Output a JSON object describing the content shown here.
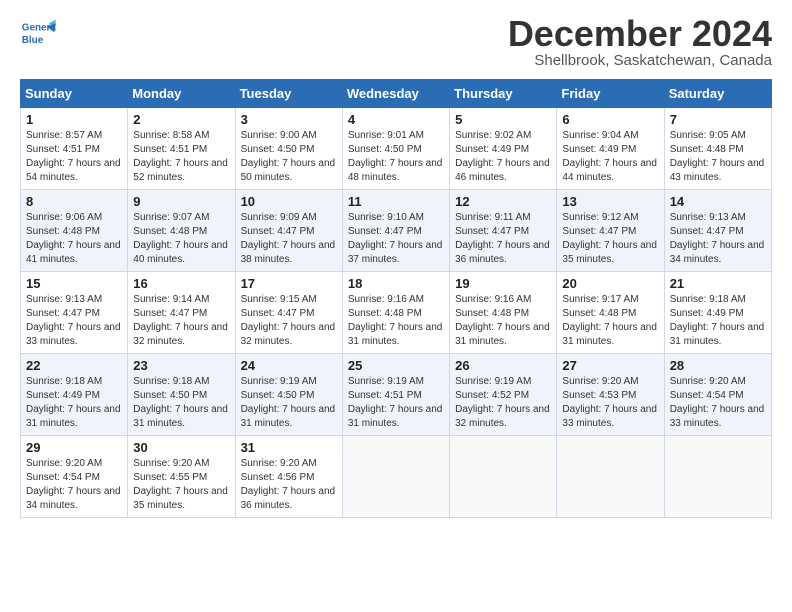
{
  "logo": {
    "line1": "General",
    "line2": "Blue"
  },
  "title": "December 2024",
  "subtitle": "Shellbrook, Saskatchewan, Canada",
  "days_of_week": [
    "Sunday",
    "Monday",
    "Tuesday",
    "Wednesday",
    "Thursday",
    "Friday",
    "Saturday"
  ],
  "weeks": [
    [
      {
        "day": 1,
        "sunrise": "8:57 AM",
        "sunset": "4:51 PM",
        "daylight": "7 hours and 54 minutes."
      },
      {
        "day": 2,
        "sunrise": "8:58 AM",
        "sunset": "4:51 PM",
        "daylight": "7 hours and 52 minutes."
      },
      {
        "day": 3,
        "sunrise": "9:00 AM",
        "sunset": "4:50 PM",
        "daylight": "7 hours and 50 minutes."
      },
      {
        "day": 4,
        "sunrise": "9:01 AM",
        "sunset": "4:50 PM",
        "daylight": "7 hours and 48 minutes."
      },
      {
        "day": 5,
        "sunrise": "9:02 AM",
        "sunset": "4:49 PM",
        "daylight": "7 hours and 46 minutes."
      },
      {
        "day": 6,
        "sunrise": "9:04 AM",
        "sunset": "4:49 PM",
        "daylight": "7 hours and 44 minutes."
      },
      {
        "day": 7,
        "sunrise": "9:05 AM",
        "sunset": "4:48 PM",
        "daylight": "7 hours and 43 minutes."
      }
    ],
    [
      {
        "day": 8,
        "sunrise": "9:06 AM",
        "sunset": "4:48 PM",
        "daylight": "7 hours and 41 minutes."
      },
      {
        "day": 9,
        "sunrise": "9:07 AM",
        "sunset": "4:48 PM",
        "daylight": "7 hours and 40 minutes."
      },
      {
        "day": 10,
        "sunrise": "9:09 AM",
        "sunset": "4:47 PM",
        "daylight": "7 hours and 38 minutes."
      },
      {
        "day": 11,
        "sunrise": "9:10 AM",
        "sunset": "4:47 PM",
        "daylight": "7 hours and 37 minutes."
      },
      {
        "day": 12,
        "sunrise": "9:11 AM",
        "sunset": "4:47 PM",
        "daylight": "7 hours and 36 minutes."
      },
      {
        "day": 13,
        "sunrise": "9:12 AM",
        "sunset": "4:47 PM",
        "daylight": "7 hours and 35 minutes."
      },
      {
        "day": 14,
        "sunrise": "9:13 AM",
        "sunset": "4:47 PM",
        "daylight": "7 hours and 34 minutes."
      }
    ],
    [
      {
        "day": 15,
        "sunrise": "9:13 AM",
        "sunset": "4:47 PM",
        "daylight": "7 hours and 33 minutes."
      },
      {
        "day": 16,
        "sunrise": "9:14 AM",
        "sunset": "4:47 PM",
        "daylight": "7 hours and 32 minutes."
      },
      {
        "day": 17,
        "sunrise": "9:15 AM",
        "sunset": "4:47 PM",
        "daylight": "7 hours and 32 minutes."
      },
      {
        "day": 18,
        "sunrise": "9:16 AM",
        "sunset": "4:48 PM",
        "daylight": "7 hours and 31 minutes."
      },
      {
        "day": 19,
        "sunrise": "9:16 AM",
        "sunset": "4:48 PM",
        "daylight": "7 hours and 31 minutes."
      },
      {
        "day": 20,
        "sunrise": "9:17 AM",
        "sunset": "4:48 PM",
        "daylight": "7 hours and 31 minutes."
      },
      {
        "day": 21,
        "sunrise": "9:18 AM",
        "sunset": "4:49 PM",
        "daylight": "7 hours and 31 minutes."
      }
    ],
    [
      {
        "day": 22,
        "sunrise": "9:18 AM",
        "sunset": "4:49 PM",
        "daylight": "7 hours and 31 minutes."
      },
      {
        "day": 23,
        "sunrise": "9:18 AM",
        "sunset": "4:50 PM",
        "daylight": "7 hours and 31 minutes."
      },
      {
        "day": 24,
        "sunrise": "9:19 AM",
        "sunset": "4:50 PM",
        "daylight": "7 hours and 31 minutes."
      },
      {
        "day": 25,
        "sunrise": "9:19 AM",
        "sunset": "4:51 PM",
        "daylight": "7 hours and 31 minutes."
      },
      {
        "day": 26,
        "sunrise": "9:19 AM",
        "sunset": "4:52 PM",
        "daylight": "7 hours and 32 minutes."
      },
      {
        "day": 27,
        "sunrise": "9:20 AM",
        "sunset": "4:53 PM",
        "daylight": "7 hours and 33 minutes."
      },
      {
        "day": 28,
        "sunrise": "9:20 AM",
        "sunset": "4:54 PM",
        "daylight": "7 hours and 33 minutes."
      }
    ],
    [
      {
        "day": 29,
        "sunrise": "9:20 AM",
        "sunset": "4:54 PM",
        "daylight": "7 hours and 34 minutes."
      },
      {
        "day": 30,
        "sunrise": "9:20 AM",
        "sunset": "4:55 PM",
        "daylight": "7 hours and 35 minutes."
      },
      {
        "day": 31,
        "sunrise": "9:20 AM",
        "sunset": "4:56 PM",
        "daylight": "7 hours and 36 minutes."
      },
      null,
      null,
      null,
      null
    ]
  ]
}
